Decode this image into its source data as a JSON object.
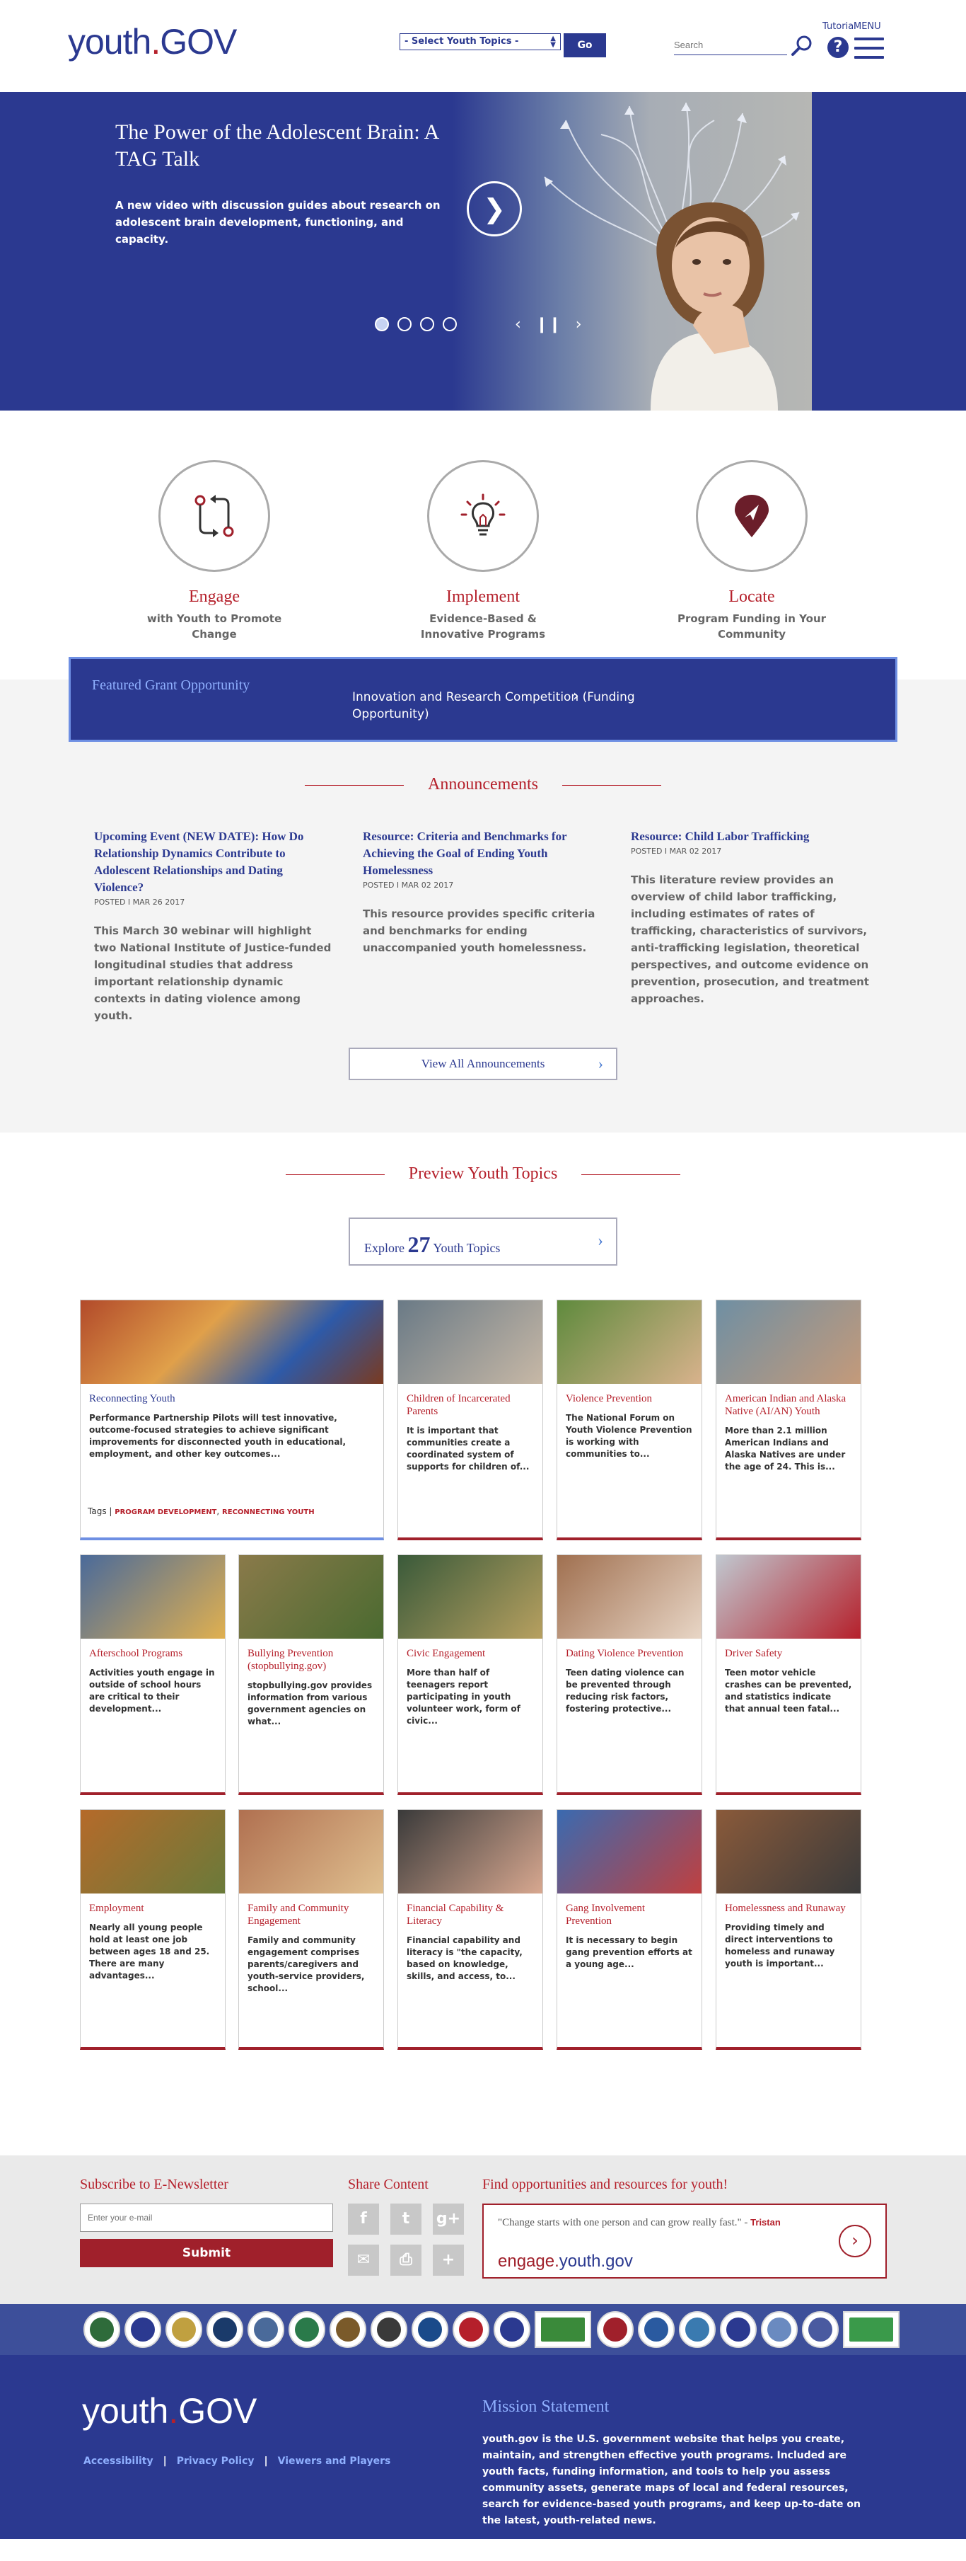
{
  "header": {
    "logo_main": "youth",
    "logo_dot": ".",
    "logo_gov": "GOV",
    "topic_select": "- Select Youth Topics -",
    "go_label": "Go",
    "search_placeholder": "Search",
    "tutorial": "Tutorial",
    "menu": "MENU",
    "help": "?"
  },
  "hero": {
    "title": "The Power of the Adolescent Brain: A TAG Talk",
    "description": "A new video with discussion guides about research on adolescent brain development, functioning, and capacity.",
    "slide_count": 4,
    "active_slide": 1
  },
  "features": [
    {
      "title": "Engage",
      "subtitle": "with Youth to Promote Change",
      "icon": "engage-icon"
    },
    {
      "title": "Implement",
      "subtitle": "Evidence-Based & Innovative Programs",
      "icon": "lightbulb-icon"
    },
    {
      "title": "Locate",
      "subtitle": "Program Funding in Your Community",
      "icon": "location-icon"
    }
  ],
  "grant": {
    "label": "Featured Grant Opportunity",
    "link": "Innovation and Research Competition (Funding Opportunity)"
  },
  "announcements": {
    "heading": "Announcements",
    "items": [
      {
        "title": "Upcoming Event (NEW DATE): How Do Relationship Dynamics Contribute to Adolescent Relationships and Dating Violence?",
        "date": "POSTED I MAR 26 2017",
        "body": "This March 30 webinar will highlight two National Institute of Justice-funded longitudinal studies that address important relationship dynamic contexts in dating violence among youth."
      },
      {
        "title": "Resource: Criteria and Benchmarks for Achieving the Goal of Ending Youth Homelessness",
        "date": "POSTED I MAR 02 2017",
        "body": "This resource provides specific criteria and benchmarks for ending unaccompanied youth homelessness."
      },
      {
        "title": "Resource: Child Labor Trafficking",
        "date": "POSTED I MAR 02 2017",
        "body": "This literature review provides an overview of child labor trafficking, including estimates of rates of trafficking, characteristics of survivors, anti-trafficking legislation, theoretical perspectives, and outcome evidence on prevention, prosecution, and treatment approaches."
      }
    ],
    "view_all": "View All Announcements"
  },
  "topics": {
    "heading": "Preview Youth Topics",
    "explore_prefix": "Explore",
    "explore_count": "27",
    "explore_suffix": "Youth Topics",
    "featured": {
      "title": "Reconnecting Youth",
      "body": "Performance Partnership Pilots will test innovative, outcome-focused strategies to achieve significant improvements for disconnected youth in educational, employment, and other key outcomes...",
      "tags_label": "Tags",
      "tags": [
        "PROGRAM DEVELOPMENT",
        "RECONNECTING YOUTH"
      ]
    },
    "tiles": [
      {
        "title": "Children of Incarcerated Parents",
        "body": "It is important that communities create a coordinated system of supports for children of..."
      },
      {
        "title": "Violence Prevention",
        "body": "The National Forum on Youth Violence Prevention is working with communities to..."
      },
      {
        "title": "American Indian and Alaska Native (AI/AN) Youth",
        "body": "More than 2.1 million American Indians and Alaska Natives are under the age of 24. This is..."
      },
      {
        "title": "Afterschool Programs",
        "body": "Activities youth engage in outside of school hours are critical to their development..."
      },
      {
        "title": "Bullying Prevention (stopbullying.gov)",
        "body": "stopbullying.gov provides information from various government agencies on what..."
      },
      {
        "title": "Civic Engagement",
        "body": "More than half of teenagers report participating in youth volunteer work, form of civic..."
      },
      {
        "title": "Dating Violence Prevention",
        "body": "Teen dating violence can be prevented through reducing risk factors, fostering protective..."
      },
      {
        "title": "Driver Safety",
        "body": "Teen motor vehicle crashes can be prevented, and statistics indicate that annual teen fatal..."
      },
      {
        "title": "Employment",
        "body": "Nearly all young people hold at least one job between ages 18 and 25. There are many advantages..."
      },
      {
        "title": "Family and Community Engagement",
        "body": "Family and community engagement comprises parents/caregivers and youth-service providers, school..."
      },
      {
        "title": "Financial Capability & Literacy",
        "body": "Financial capability and literacy is \"the capacity, based on knowledge, skills, and access, to..."
      },
      {
        "title": "Gang Involvement Prevention",
        "body": "It is necessary to begin gang prevention efforts at a young age..."
      },
      {
        "title": "Homelessness and Runaway",
        "body": "Providing timely and direct interventions to homeless and runaway youth is important..."
      }
    ]
  },
  "subscribe": {
    "heading": "Subscribe to E-Newsletter",
    "placeholder": "Enter your e-mail",
    "submit": "Submit"
  },
  "share": {
    "heading": "Share Content",
    "icons": [
      "f",
      "t",
      "g+",
      "✉",
      "⎙",
      "+"
    ]
  },
  "find": {
    "heading": "Find opportunities and resources for youth!",
    "quote": "\"Change starts with one person and can grow really fast.\" -",
    "author": "Tristan",
    "engage_a": "engage.",
    "engage_b": "youth.gov"
  },
  "agencies_count": 19,
  "footer": {
    "logo_main": "youth",
    "logo_dot": ".",
    "logo_gov": "GOV",
    "links": [
      "Accessibility",
      "Privacy Policy",
      "Viewers and Players"
    ],
    "mission_title": "Mission Statement",
    "mission_body": "youth.gov is the U.S. government website that helps you create, maintain, and strengthen effective youth programs. Included are youth facts, funding information, and tools to help you assess community assets, generate maps of local and federal resources, search for evidence-based youth programs, and keep up-to-date on the latest, youth-related news."
  },
  "colors": {
    "brand_blue": "#2b3990",
    "accent_red": "#b5202b",
    "light_blue": "#8fb0ff"
  }
}
